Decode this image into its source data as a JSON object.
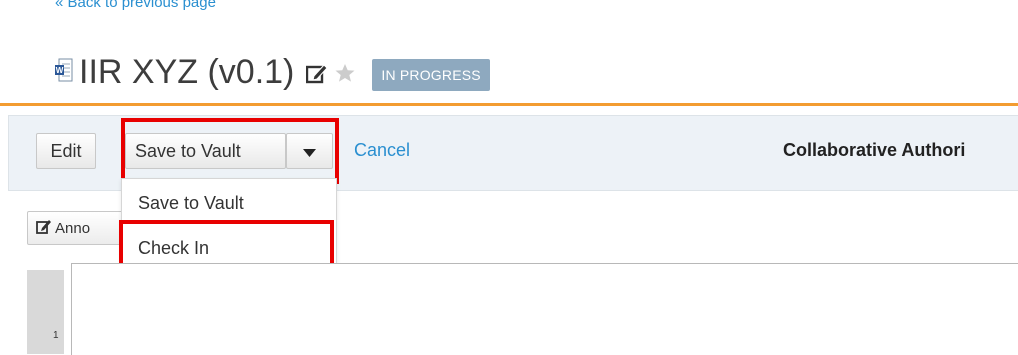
{
  "header": {
    "back_link": "« Back to previous page",
    "doc_icon": "word-doc-icon",
    "title": "IIR XYZ (v0.1)",
    "edit_icon": "edit-pencil-icon",
    "star_icon": "star-icon",
    "status": "IN PROGRESS"
  },
  "toolbar": {
    "edit_label": "Edit",
    "save_label": "Save to Vault",
    "caret_icon": "caret-down-icon",
    "cancel_label": "Cancel",
    "mode_label": "Collaborative Authori"
  },
  "dropdown": {
    "items": [
      {
        "label": "Save to Vault"
      },
      {
        "label": "Check In"
      }
    ]
  },
  "secondary_toolbar": {
    "annotate_label": "Anno",
    "annotate_icon": "annotate-pencil-icon"
  },
  "editor": {
    "page_number": "1"
  },
  "colors": {
    "accent_orange": "#f39c31",
    "highlight_red": "#e80000",
    "link_blue": "#2a8fd0",
    "badge_bg": "#8ea9bf",
    "toolbar_bg": "#edf2f7"
  }
}
